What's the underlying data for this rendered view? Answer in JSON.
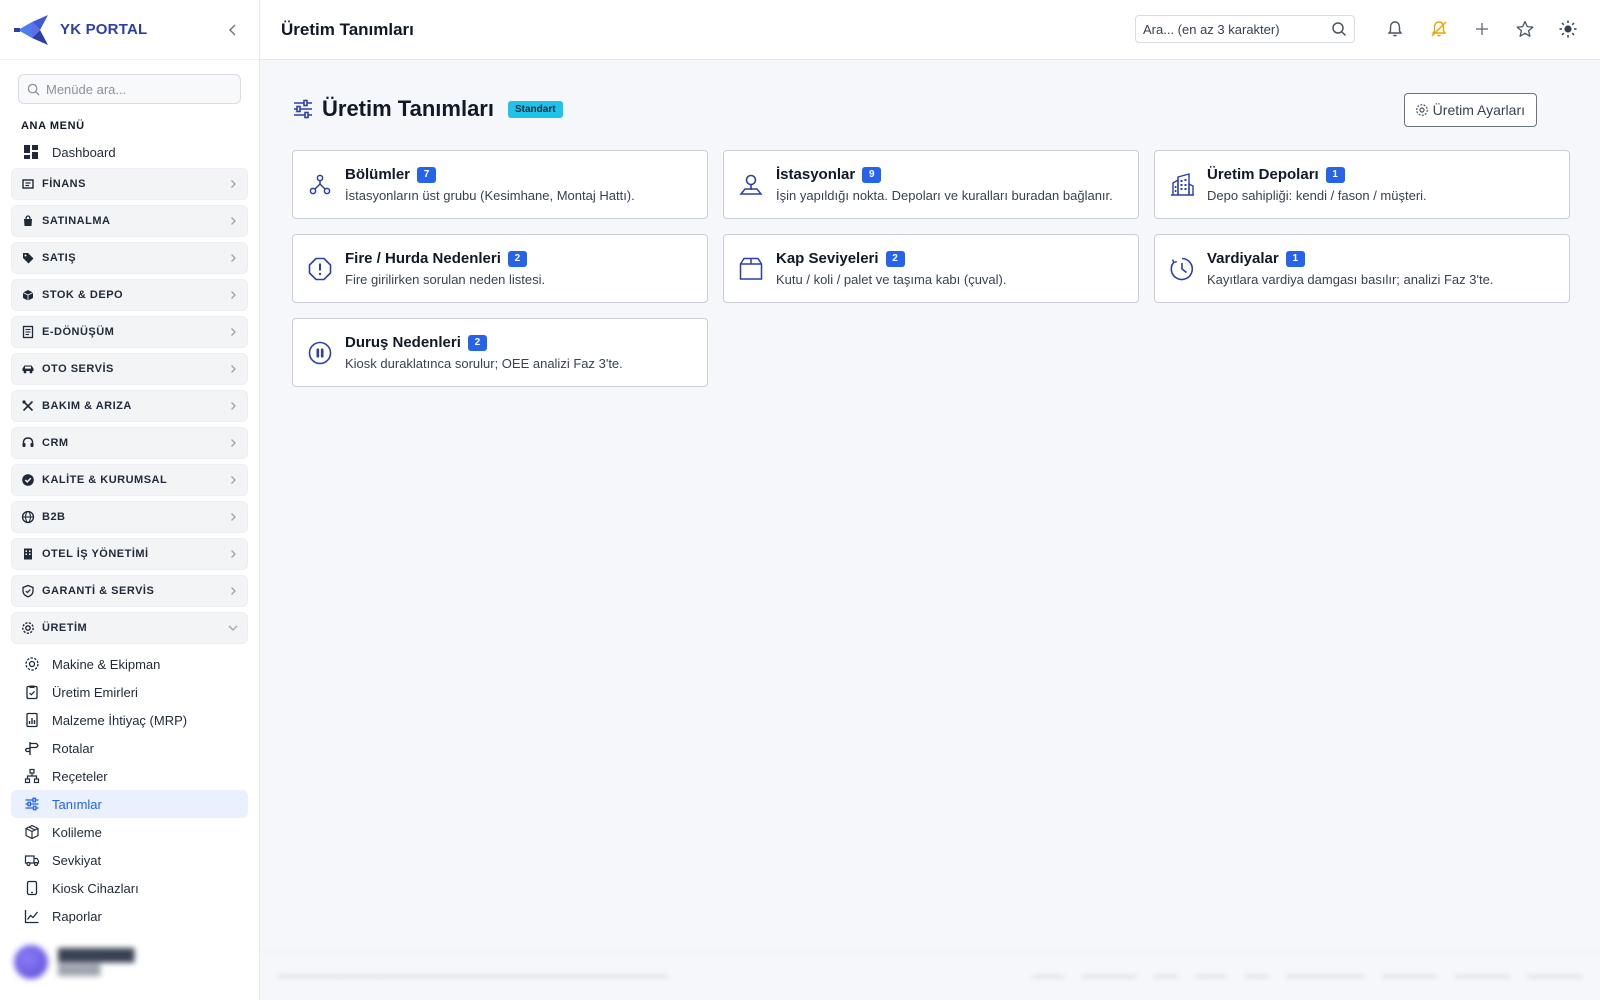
{
  "brand": {
    "name": "YK PORTAL"
  },
  "sidebar": {
    "search_placeholder": "Menüde ara...",
    "section_title": "ANA MENÜ",
    "dashboard_label": "Dashboard",
    "groups": [
      {
        "label": "FİNANS",
        "icon": "finance-icon"
      },
      {
        "label": "SATINALMA",
        "icon": "shopping-bag-icon"
      },
      {
        "label": "SATIŞ",
        "icon": "tag-icon"
      },
      {
        "label": "STOK & DEPO",
        "icon": "box-icon"
      },
      {
        "label": "E-DÖNÜŞÜM",
        "icon": "document-icon"
      },
      {
        "label": "OTO SERVİS",
        "icon": "car-icon"
      },
      {
        "label": "BAKIM & ARIZA",
        "icon": "tools-icon"
      },
      {
        "label": "CRM",
        "icon": "headset-icon"
      },
      {
        "label": "KALİTE & KURUMSAL",
        "icon": "verified-icon"
      },
      {
        "label": "B2B",
        "icon": "globe-icon"
      },
      {
        "label": "OTEL İŞ YÖNETİMİ",
        "icon": "building-icon"
      },
      {
        "label": "GARANTİ & SERVİS",
        "icon": "shield-icon"
      }
    ],
    "expanded_group": {
      "label": "ÜRETİM",
      "icon": "gear-icon"
    },
    "sub_items": [
      {
        "label": "Makine & Ekipman",
        "icon": "machine-icon"
      },
      {
        "label": "Üretim Emirleri",
        "icon": "clipboard-icon"
      },
      {
        "label": "Malzeme İhtiyaç (MRP)",
        "icon": "chart-doc-icon"
      },
      {
        "label": "Rotalar",
        "icon": "signpost-icon"
      },
      {
        "label": "Reçeteler",
        "icon": "hierarchy-icon"
      },
      {
        "label": "Tanımlar",
        "icon": "sliders-icon",
        "active": true
      },
      {
        "label": "Kolileme",
        "icon": "package-icon"
      },
      {
        "label": "Sevkiyat",
        "icon": "truck-icon"
      },
      {
        "label": "Kiosk Cihazları",
        "icon": "tablet-icon"
      },
      {
        "label": "Raporlar",
        "icon": "line-chart-icon"
      }
    ]
  },
  "topbar": {
    "title": "Üretim Tanımları",
    "search_placeholder": "Ara... (en az 3 karakter)"
  },
  "page": {
    "title": "Üretim Tanımları",
    "badge": "Standart",
    "settings_button": "Üretim Ayarları"
  },
  "cards": [
    {
      "title": "Bölümler",
      "count": "7",
      "desc": "İstasyonların üst grubu (Kesimhane, Montaj Hattı).",
      "icon": "org-icon"
    },
    {
      "title": "İstasyonlar",
      "count": "9",
      "desc": "İşin yapıldığı nokta. Depoları ve kuralları buradan bağlanır.",
      "icon": "location-icon"
    },
    {
      "title": "Üretim Depoları",
      "count": "1",
      "desc": "Depo sahipliği: kendi / fason / müşteri.",
      "icon": "warehouse-icon"
    },
    {
      "title": "Fire / Hurda Nedenleri",
      "count": "2",
      "desc": "Fire girilirken sorulan neden listesi.",
      "icon": "warning-icon"
    },
    {
      "title": "Kap Seviyeleri",
      "count": "2",
      "desc": "Kutu / koli / palet ve taşıma kabı (çuval).",
      "icon": "box-icon"
    },
    {
      "title": "Vardiyalar",
      "count": "1",
      "desc": "Kayıtlara vardiya damgası basılır; analizi Faz 3'te.",
      "icon": "clock-icon"
    },
    {
      "title": "Duruş Nedenleri",
      "count": "2",
      "desc": "Kiosk duraklatınca sorulur; OEE analizi Faz 3'te.",
      "icon": "pause-icon"
    }
  ],
  "colors": {
    "accent": "#2563eb",
    "brand": "#2c3fa8",
    "badge": "#1ec3ea",
    "active_bg": "#eaf0fd"
  }
}
